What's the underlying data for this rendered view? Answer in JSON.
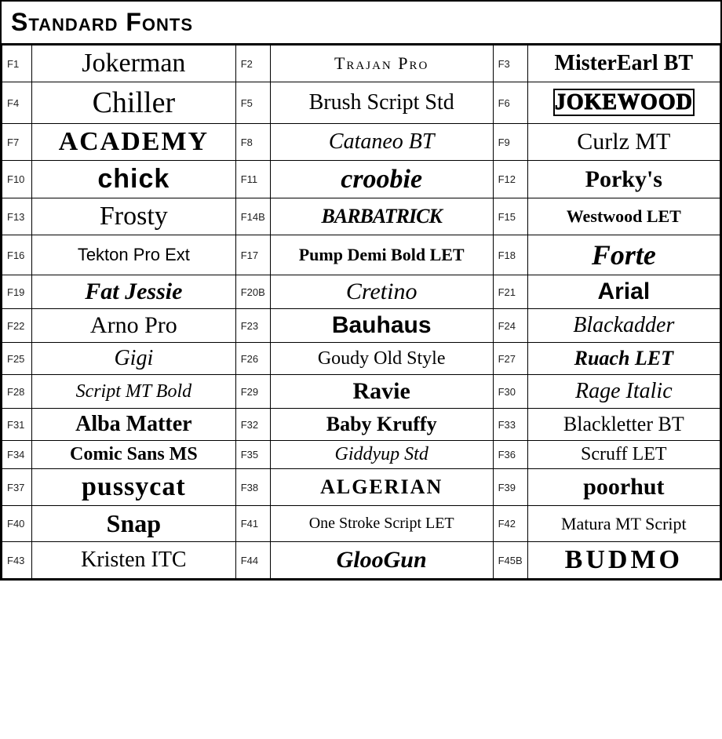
{
  "title": "Standard Fonts",
  "fonts": [
    {
      "row": 0,
      "items": [
        {
          "code": "F1",
          "name": "Jokerman",
          "cls": "f-jokerman"
        },
        {
          "code": "F2",
          "name": "Trajan Pro",
          "cls": "f-trajan"
        },
        {
          "code": "F3",
          "name": "MisterEarl BT",
          "cls": "f-misterearl"
        }
      ]
    },
    {
      "row": 1,
      "items": [
        {
          "code": "F4",
          "name": "Chiller",
          "cls": "f-chiller"
        },
        {
          "code": "F5",
          "name": "Brush Script Std",
          "cls": "f-brushscript"
        },
        {
          "code": "F6",
          "name": "JOKEWOOD",
          "cls": "f-jokewood"
        }
      ]
    },
    {
      "row": 2,
      "items": [
        {
          "code": "F7",
          "name": "ACADEMY",
          "cls": "f-academy"
        },
        {
          "code": "F8",
          "name": "Cataneo BT",
          "cls": "f-cataneo"
        },
        {
          "code": "F9",
          "name": "Curlz MT",
          "cls": "f-curlz"
        }
      ]
    },
    {
      "row": 3,
      "items": [
        {
          "code": "F10",
          "name": "chick",
          "cls": "f-chick"
        },
        {
          "code": "F11",
          "name": "croobie",
          "cls": "f-croobie"
        },
        {
          "code": "F12",
          "name": "Porky's",
          "cls": "f-porkys"
        }
      ]
    },
    {
      "row": 4,
      "items": [
        {
          "code": "F13",
          "name": "Frosty",
          "cls": "f-frosty"
        },
        {
          "code": "F14B",
          "name": "BARBATRICK",
          "cls": "f-barbatrick"
        },
        {
          "code": "F15",
          "name": "Westwood LET",
          "cls": "f-westwood"
        }
      ]
    },
    {
      "row": 5,
      "items": [
        {
          "code": "F16",
          "name": "Tekton Pro Ext",
          "cls": "f-tekton"
        },
        {
          "code": "F17",
          "name": "Pump Demi Bold LET",
          "cls": "f-pump"
        },
        {
          "code": "F18",
          "name": "Forte",
          "cls": "f-forte"
        }
      ]
    },
    {
      "row": 6,
      "items": [
        {
          "code": "F19",
          "name": "Fat Jessie",
          "cls": "f-fatjessie"
        },
        {
          "code": "F20B",
          "name": "Cretino",
          "cls": "f-cretino"
        },
        {
          "code": "F21",
          "name": "Arial",
          "cls": "f-arial"
        }
      ]
    },
    {
      "row": 7,
      "items": [
        {
          "code": "F22",
          "name": "Arno Pro",
          "cls": "f-arnopro"
        },
        {
          "code": "F23",
          "name": "Bauhaus",
          "cls": "f-bauhaus"
        },
        {
          "code": "F24",
          "name": "Blackadder",
          "cls": "f-blackadder"
        }
      ]
    },
    {
      "row": 8,
      "items": [
        {
          "code": "F25",
          "name": "Gigi",
          "cls": "f-gigi"
        },
        {
          "code": "F26",
          "name": "Goudy Old Style",
          "cls": "f-goudy"
        },
        {
          "code": "F27",
          "name": "Ruach LET",
          "cls": "f-ruachlet"
        }
      ]
    },
    {
      "row": 9,
      "items": [
        {
          "code": "F28",
          "name": "Script MT Bold",
          "cls": "f-scriptmt"
        },
        {
          "code": "F29",
          "name": "Ravie",
          "cls": "f-ravie"
        },
        {
          "code": "F30",
          "name": "Rage Italic",
          "cls": "f-rageit"
        }
      ]
    },
    {
      "row": 10,
      "items": [
        {
          "code": "F31",
          "name": "Alba Matter",
          "cls": "f-albamatter"
        },
        {
          "code": "F32",
          "name": "Baby Kruffy",
          "cls": "f-babykruffy"
        },
        {
          "code": "F33",
          "name": "Blackletter BT",
          "cls": "f-blackletter"
        }
      ]
    },
    {
      "row": 11,
      "items": [
        {
          "code": "F34",
          "name": "Comic Sans MS",
          "cls": "f-comicsans"
        },
        {
          "code": "F35",
          "name": "Giddyup Std",
          "cls": "f-giddyup"
        },
        {
          "code": "F36",
          "name": "Scruff LET",
          "cls": "f-scruff"
        }
      ]
    },
    {
      "row": 12,
      "items": [
        {
          "code": "F37",
          "name": "pussycat",
          "cls": "f-pussycat"
        },
        {
          "code": "F38",
          "name": "ALGERIAN",
          "cls": "f-algerian"
        },
        {
          "code": "F39",
          "name": "poorhut",
          "cls": "f-poorhut"
        }
      ]
    },
    {
      "row": 13,
      "items": [
        {
          "code": "F40",
          "name": "Snap",
          "cls": "f-snap"
        },
        {
          "code": "F41",
          "name": "One Stroke Script LET",
          "cls": "f-onestroke"
        },
        {
          "code": "F42",
          "name": "Matura MT Script",
          "cls": "f-matura"
        }
      ]
    },
    {
      "row": 14,
      "items": [
        {
          "code": "F43",
          "name": "Kristen ITC",
          "cls": "f-kristen"
        },
        {
          "code": "F44",
          "name": "GlooGun",
          "cls": "f-gloogun"
        },
        {
          "code": "F45B",
          "name": "BUDMO",
          "cls": "f-budmo"
        }
      ]
    }
  ]
}
